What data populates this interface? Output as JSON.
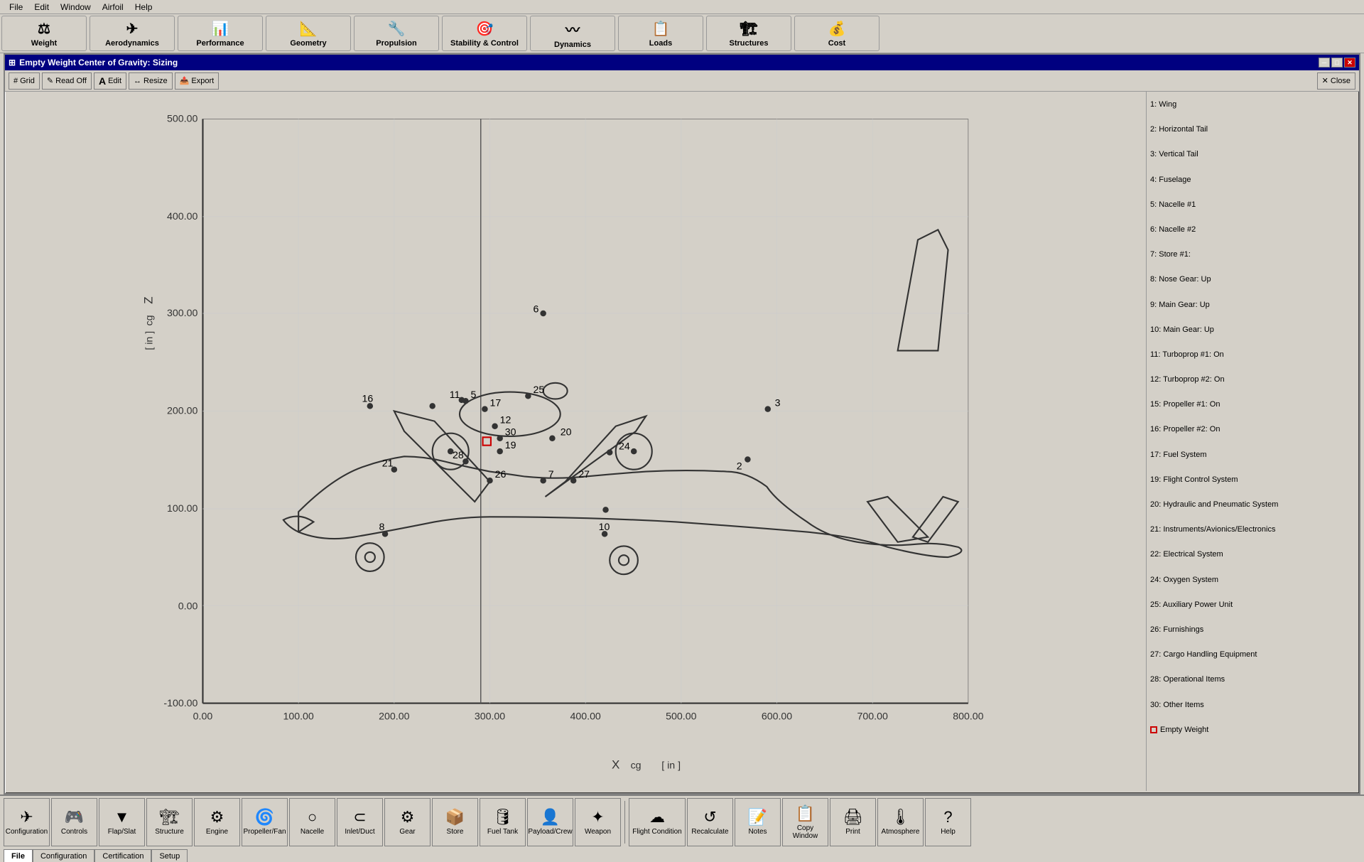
{
  "menu": {
    "items": [
      "File",
      "Edit",
      "Window",
      "Airfoil",
      "Help"
    ]
  },
  "top_toolbar": {
    "buttons": [
      {
        "id": "weight",
        "label": "Weight",
        "icon": "⚖"
      },
      {
        "id": "aerodynamics",
        "label": "Aerodynamics",
        "icon": "✈"
      },
      {
        "id": "performance",
        "label": "Performance",
        "icon": "📊"
      },
      {
        "id": "geometry",
        "label": "Geometry",
        "icon": "📐"
      },
      {
        "id": "propulsion",
        "label": "Propulsion",
        "icon": "🔧"
      },
      {
        "id": "stability",
        "label": "Stability & Control",
        "icon": "🎯"
      },
      {
        "id": "dynamics",
        "label": "Dynamics",
        "icon": "〰"
      },
      {
        "id": "loads",
        "label": "Loads",
        "icon": "📋"
      },
      {
        "id": "structures",
        "label": "Structures",
        "icon": "🏗"
      },
      {
        "id": "cost",
        "label": "Cost",
        "icon": "💰"
      }
    ]
  },
  "window": {
    "title": "Empty Weight Center of Gravity: Sizing",
    "close_btn": "✕",
    "min_btn": "─",
    "max_btn": "□"
  },
  "inner_toolbar": {
    "buttons": [
      {
        "id": "grid",
        "label": "Grid",
        "icon": "#"
      },
      {
        "id": "readoff",
        "label": "Read Off",
        "icon": "✎"
      },
      {
        "id": "edit",
        "label": "Edit",
        "icon": "A"
      },
      {
        "id": "resize",
        "label": "Resize",
        "icon": "↔"
      },
      {
        "id": "export",
        "label": "Export",
        "icon": "📤"
      },
      {
        "id": "close",
        "label": "Close",
        "icon": "✕"
      }
    ]
  },
  "chart": {
    "title": "Empty Weight Center of Gravity: Sizing",
    "x_axis_label": "X",
    "x_axis_unit": "[ in ]",
    "y_axis_label": "Z",
    "y_axis_unit": "[ in ]",
    "x_ticks": [
      "0.00",
      "100.00",
      "200.00",
      "300.00",
      "400.00",
      "500.00",
      "600.00",
      "700.00",
      "800.00"
    ],
    "y_ticks": [
      "-100.00",
      "0.00",
      "100.00",
      "200.00",
      "300.00",
      "400.00",
      "500.00"
    ]
  },
  "legend": {
    "items": [
      "1: Wing",
      "2: Horizontal Tail",
      "3: Vertical Tail",
      "4: Fuselage",
      "5: Nacelle #1",
      "6: Nacelle #2",
      "7: Store #1:",
      "8: Nose Gear: Up",
      "9: Main Gear: Up",
      "10: Main Gear: Up",
      "11: Turboprop #1: On",
      "12: Turboprop #2: On",
      "15: Propeller #1: On",
      "16: Propeller #2: On",
      "17: Fuel System",
      "19: Flight Control System",
      "20: Hydraulic and Pneumatic System",
      "21: Instruments/Avionics/Electronics",
      "22: Electrical System",
      "24: Oxygen System",
      "25: Auxiliary Power Unit",
      "26: Furnishings",
      "27: Cargo Handling Equipment",
      "28: Operational Items",
      "30: Other Items",
      "□ Empty Weight"
    ]
  },
  "bottom_toolbar": {
    "buttons_left": [
      {
        "id": "configuration",
        "label": "Configuration",
        "icon": "✈"
      },
      {
        "id": "controls",
        "label": "Controls",
        "icon": "🎮"
      },
      {
        "id": "flap_slat",
        "label": "Flap/Slat",
        "icon": "▼"
      },
      {
        "id": "structure",
        "label": "Structure",
        "icon": "🏗"
      },
      {
        "id": "engine",
        "label": "Engine",
        "icon": "⚙"
      },
      {
        "id": "propeller_fan",
        "label": "Propeller/Fan",
        "icon": "🌀"
      },
      {
        "id": "nacelle",
        "label": "Nacelle",
        "icon": "○"
      },
      {
        "id": "inlet_duct",
        "label": "Inlet/Duct",
        "icon": "⊂"
      },
      {
        "id": "gear",
        "label": "Gear",
        "icon": "⚙"
      },
      {
        "id": "store",
        "label": "Store",
        "icon": "📦"
      },
      {
        "id": "fuel_tank",
        "label": "Fuel Tank",
        "icon": "🛢"
      },
      {
        "id": "payload_crew",
        "label": "Payload/Crew",
        "icon": "👤"
      },
      {
        "id": "weapon",
        "label": "Weapon",
        "icon": "✦"
      }
    ],
    "buttons_right": [
      {
        "id": "flight_condition",
        "label": "Flight Condition",
        "icon": "☁"
      },
      {
        "id": "recalculate",
        "label": "Recalculate",
        "icon": "↺"
      },
      {
        "id": "notes",
        "label": "Notes",
        "icon": "📝"
      },
      {
        "id": "copy_window",
        "label": "Copy Window",
        "icon": "📋"
      },
      {
        "id": "print",
        "label": "Print",
        "icon": "🖨"
      },
      {
        "id": "atmosphere",
        "label": "Atmosphere",
        "icon": "🌡"
      },
      {
        "id": "help",
        "label": "Help",
        "icon": "?"
      }
    ],
    "tabs": [
      "File",
      "Configuration",
      "Certification",
      "Setup"
    ]
  }
}
